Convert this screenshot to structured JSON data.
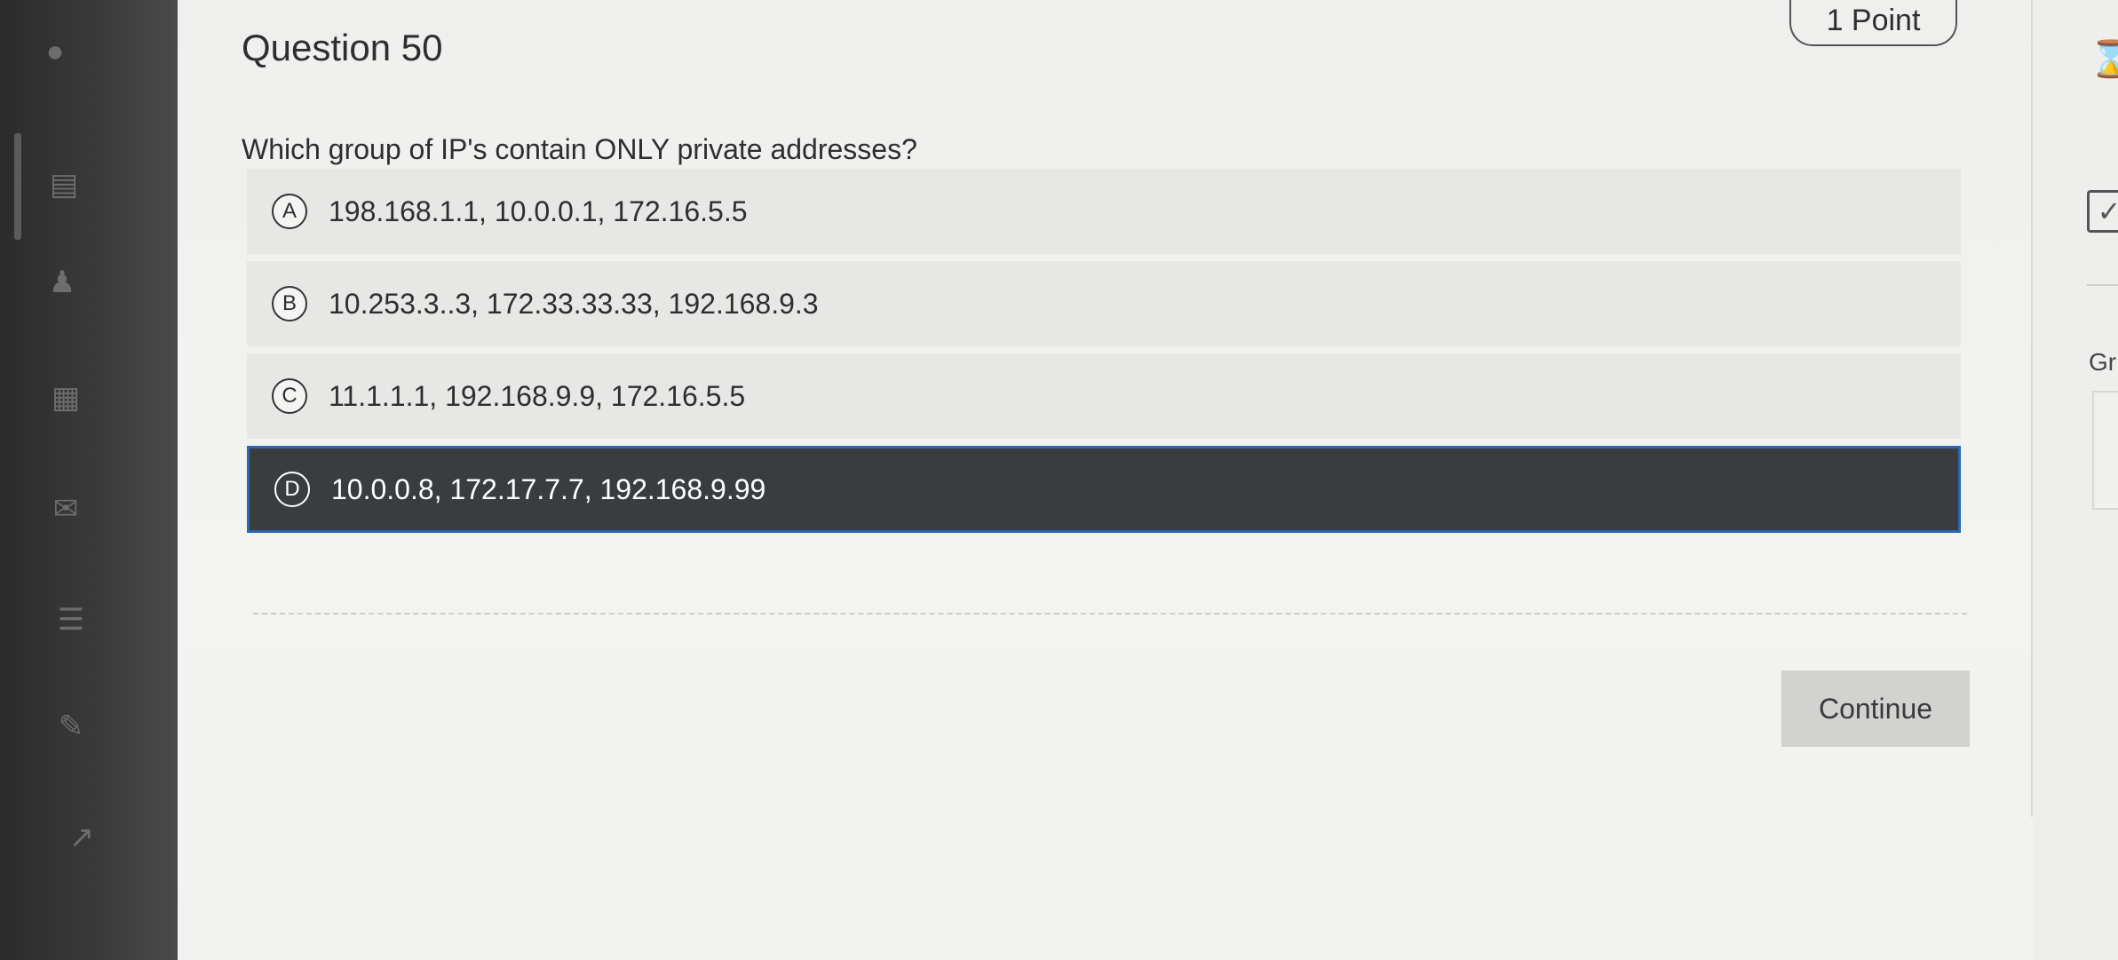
{
  "question": {
    "title": "Question 50",
    "points": "1 Point",
    "text": "Which group of IP's contain ONLY private addresses?"
  },
  "options": [
    {
      "letter": "A",
      "text": "198.168.1.1, 10.0.0.1, 172.16.5.5",
      "selected": false
    },
    {
      "letter": "B",
      "text": "10.253.3..3, 172.33.33.33, 192.168.9.3",
      "selected": false
    },
    {
      "letter": "C",
      "text": "11.1.1.1, 192.168.9.9, 172.16.5.5",
      "selected": false
    },
    {
      "letter": "D",
      "text": "10.0.0.8, 172.17.7.7, 192.168.9.99",
      "selected": true
    }
  ],
  "continue_label": "Continue",
  "right_panel": {
    "label": "Gr"
  },
  "colors": {
    "selected_bg": "#3a3d40",
    "selected_border": "#2b68b0",
    "option_bg": "#e7e7e5",
    "rail_bg": "#2b2b2b"
  },
  "icons": {
    "rail": [
      "globe-icon",
      "book-icon",
      "people-icon",
      "calendar-icon",
      "mail-icon",
      "list-icon",
      "edit-icon",
      "external-icon"
    ],
    "right": [
      "hourglass-icon",
      "checkbox-icon"
    ]
  }
}
